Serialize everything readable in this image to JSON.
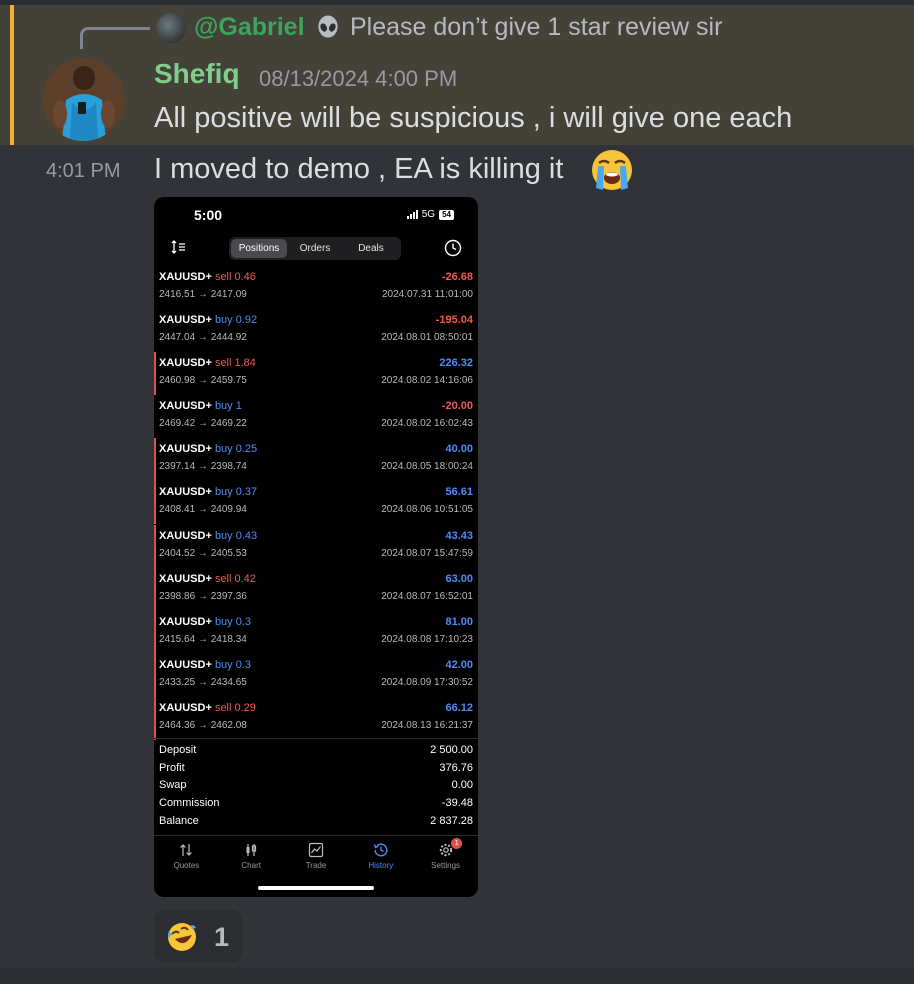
{
  "reply": {
    "name": "@Gabriel",
    "name_emoji": "alien-icon",
    "text": "Please don’t give 1 star review sir"
  },
  "message1": {
    "author": "Shefiq",
    "timestamp": "08/13/2024 4:00 PM",
    "text": "All positive will be suspicious , i will give one each"
  },
  "message2": {
    "time": "4:01 PM",
    "text": "I moved to demo , EA is killing it",
    "emoji": "loudly-crying-face"
  },
  "phone": {
    "clock": "5:00",
    "network": "5G",
    "battery": "54",
    "tabs": [
      {
        "label": "Positions",
        "active": true
      },
      {
        "label": "Orders",
        "active": false
      },
      {
        "label": "Deals",
        "active": false
      }
    ],
    "trades": [
      {
        "symbol": "XAUUSD+",
        "dir": "sell",
        "dir_text": "sell 0.46",
        "prices": "2416.51 → 2417.09",
        "profit": "-26.68",
        "date": "2024.07.31 11:01:00",
        "marked": false
      },
      {
        "symbol": "XAUUSD+",
        "dir": "buy",
        "dir_text": "buy 0.92",
        "prices": "2447.04 → 2444.92",
        "profit": "-195.04",
        "date": "2024.08.01 08:50:01",
        "marked": false
      },
      {
        "symbol": "XAUUSD+",
        "dir": "sell",
        "dir_text": "sell 1.84",
        "prices": "2460.98 → 2459.75",
        "profit": "226.32",
        "date": "2024.08.02 14:16:06",
        "marked": true
      },
      {
        "symbol": "XAUUSD+",
        "dir": "buy",
        "dir_text": "buy 1",
        "prices": "2469.42 → 2469.22",
        "profit": "-20.00",
        "date": "2024.08.02 16:02:43",
        "marked": false
      },
      {
        "symbol": "XAUUSD+",
        "dir": "buy",
        "dir_text": "buy 0.25",
        "prices": "2397.14 → 2398.74",
        "profit": "40.00",
        "date": "2024.08.05 18:00:24",
        "marked": true
      },
      {
        "symbol": "XAUUSD+",
        "dir": "buy",
        "dir_text": "buy 0.37",
        "prices": "2408.41 → 2409.94",
        "profit": "56.61",
        "date": "2024.08.06 10:51:05",
        "marked": true
      },
      {
        "symbol": "XAUUSD+",
        "dir": "buy",
        "dir_text": "buy 0.43",
        "prices": "2404.52 → 2405.53",
        "profit": "43.43",
        "date": "2024.08.07 15:47:59",
        "marked": true
      },
      {
        "symbol": "XAUUSD+",
        "dir": "sell",
        "dir_text": "sell 0.42",
        "prices": "2398.86 → 2397.36",
        "profit": "63.00",
        "date": "2024.08.07 16:52:01",
        "marked": true
      },
      {
        "symbol": "XAUUSD+",
        "dir": "buy",
        "dir_text": "buy 0.3",
        "prices": "2415.64 → 2418.34",
        "profit": "81.00",
        "date": "2024.08.08 17:10:23",
        "marked": true
      },
      {
        "symbol": "XAUUSD+",
        "dir": "buy",
        "dir_text": "buy 0.3",
        "prices": "2433.25 → 2434.65",
        "profit": "42.00",
        "date": "2024.08.09 17:30:52",
        "marked": true
      },
      {
        "symbol": "XAUUSD+",
        "dir": "sell",
        "dir_text": "sell 0.29",
        "prices": "2464.36 → 2462.08",
        "profit": "66.12",
        "date": "2024.08.13 16:21:37",
        "marked": true
      }
    ],
    "summary": [
      {
        "label": "Deposit",
        "value": "2 500.00"
      },
      {
        "label": "Profit",
        "value": "376.76"
      },
      {
        "label": "Swap",
        "value": "0.00"
      },
      {
        "label": "Commission",
        "value": "-39.48"
      },
      {
        "label": "Balance",
        "value": "2 837.28"
      }
    ],
    "nav": [
      {
        "label": "Quotes",
        "icon": "quotes-icon",
        "active": false
      },
      {
        "label": "Chart",
        "icon": "chart-icon",
        "active": false
      },
      {
        "label": "Trade",
        "icon": "trade-icon",
        "active": false
      },
      {
        "label": "History",
        "icon": "history-icon",
        "active": true
      },
      {
        "label": "Settings",
        "icon": "settings-icon",
        "active": false,
        "badge": "1"
      }
    ]
  },
  "reaction": {
    "emoji": "rolling-on-floor-laughing",
    "count": "1"
  },
  "colors": {
    "background": "#313338",
    "mention_highlight": "#444139",
    "mention_bar": "#f0b132",
    "author": "#7fcf8b",
    "reply_name": "#3ba55c",
    "sell": "#f0594f",
    "buy": "#4d8df5"
  }
}
